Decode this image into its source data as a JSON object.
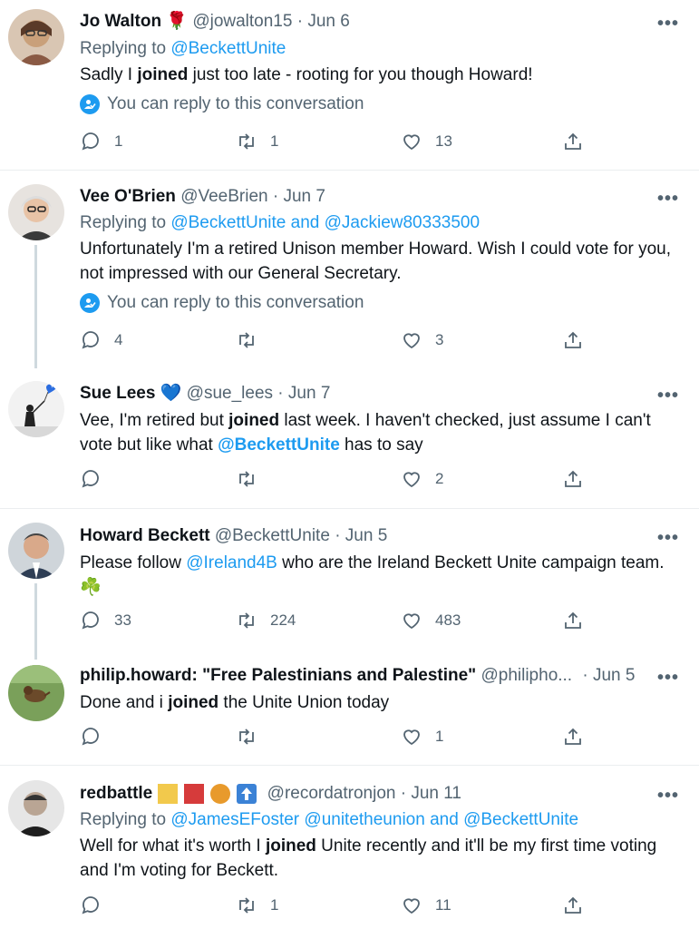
{
  "more_label": "•••",
  "notice_text": "You can reply to this conversation",
  "tweets": [
    {
      "name": "Jo Walton",
      "emoji": "🌹",
      "handle": "@jowalton15",
      "date": "· Jun 6",
      "replying_label": "Replying to",
      "replying_to": [
        "@BeckettUnite"
      ],
      "text_pre": "Sadly I ",
      "text_bold": "joined",
      "text_post": " just too late - rooting for you though Howard!",
      "replies": "1",
      "retweets": "1",
      "likes": "13"
    },
    {
      "name": "Vee O'Brien",
      "handle": "@VeeBrien",
      "date": "· Jun 7",
      "replying_label": "Replying to",
      "replying_to": [
        "@BeckettUnite",
        "and",
        "@Jackiew80333500"
      ],
      "text": "Unfortunately I'm a retired Unison member Howard. Wish I could vote for you, not impressed with our General Secretary.",
      "replies": "4",
      "retweets": "",
      "likes": "3"
    },
    {
      "name": "Sue Lees",
      "emoji": "💙",
      "handle": "@sue_lees",
      "date": "· Jun 7",
      "text_pre": "Vee, I'm retired but ",
      "text_bold": "joined",
      "text_mid": " last week. I haven't checked, just assume I can't vote but like what ",
      "text_mention": "@BeckettUnite",
      "text_post": " has to say",
      "replies": "",
      "retweets": "",
      "likes": "2"
    },
    {
      "name": "Howard Beckett",
      "handle": "@BeckettUnite",
      "date": "· Jun 5",
      "text_pre": "Please follow ",
      "text_mention": "@Ireland4B",
      "text_post": " who are the Ireland Beckett Unite campaign team.",
      "text_line2": "☘️",
      "replies": "33",
      "retweets": "224",
      "likes": "483"
    },
    {
      "name": "philip.howard: \"Free Palestinians and Palestine\"",
      "handle": "@philipho...",
      "date": "· Jun 5",
      "text_pre": "Done and i ",
      "text_bold": "joined",
      "text_post": " the Unite Union today",
      "replies": "",
      "retweets": "",
      "likes": "1"
    },
    {
      "name": "redbattle",
      "handle": "@recordatronjon",
      "date": "· Jun 11",
      "replying_label": "Replying to",
      "replying_to": [
        "@JamesEFoster",
        "@unitetheunion",
        "and",
        "@BeckettUnite"
      ],
      "text_pre": "Well for what it's worth I ",
      "text_bold": "joined",
      "text_post": " Unite recently and it'll be my first time voting and I'm voting for Beckett.",
      "badge_colors": [
        "#f2c94c",
        "#d63b3b",
        "#e89a2c",
        "#3b82d6"
      ],
      "replies": "",
      "retweets": "1",
      "likes": "11"
    }
  ],
  "colors": {
    "link": "#1d9bf0",
    "muted": "#536471",
    "thread": "#cfd9de"
  },
  "icons": [
    "reply-icon",
    "retweet-icon",
    "like-icon",
    "share-icon",
    "more-icon",
    "conversation-icon"
  ]
}
